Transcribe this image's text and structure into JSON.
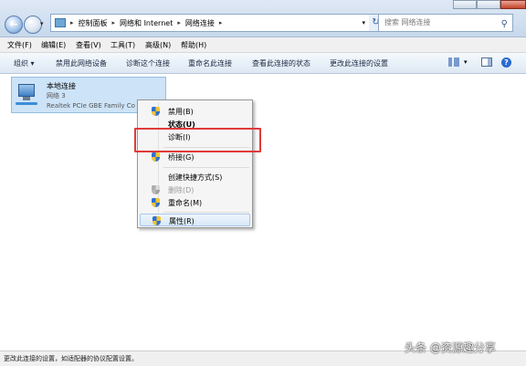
{
  "address": {
    "crumbs": [
      "控制面板",
      "网络和 Internet",
      "网络连接"
    ]
  },
  "search": {
    "placeholder": "搜索 网络连接"
  },
  "menubar": [
    "文件(F)",
    "编辑(E)",
    "查看(V)",
    "工具(T)",
    "高级(N)",
    "帮助(H)"
  ],
  "toolbar": {
    "organize": "组织 ▾",
    "actions": [
      "禁用此网络设备",
      "诊断这个连接",
      "重命名此连接",
      "查看此连接的状态",
      "更改此连接的设置"
    ]
  },
  "connection": {
    "name": "本地连接",
    "network": "网络  3",
    "adapter": "Realtek PCIe GBE Family Co"
  },
  "context_menu": {
    "items": [
      {
        "label": "禁用(B)",
        "shield": true,
        "disabled": false
      },
      {
        "label": "状态(U)",
        "shield": false,
        "disabled": false
      },
      {
        "label": "诊断(I)",
        "shield": false,
        "disabled": false
      },
      {
        "label": "桥接(G)",
        "shield": true,
        "disabled": false
      },
      {
        "label": "创建快捷方式(S)",
        "shield": false,
        "disabled": false
      },
      {
        "label": "删除(D)",
        "shield": true,
        "disabled": true
      },
      {
        "label": "重命名(M)",
        "shield": true,
        "disabled": false
      },
      {
        "label": "属性(R)",
        "shield": true,
        "disabled": false,
        "highlighted": true
      }
    ]
  },
  "status_text": "更改此连接的设置，如适配器的协议配置设置。",
  "watermark": "头条 @资源趣分享",
  "colors": {
    "highlight_box": "#e03a3a",
    "selection": "#cde3f7"
  }
}
